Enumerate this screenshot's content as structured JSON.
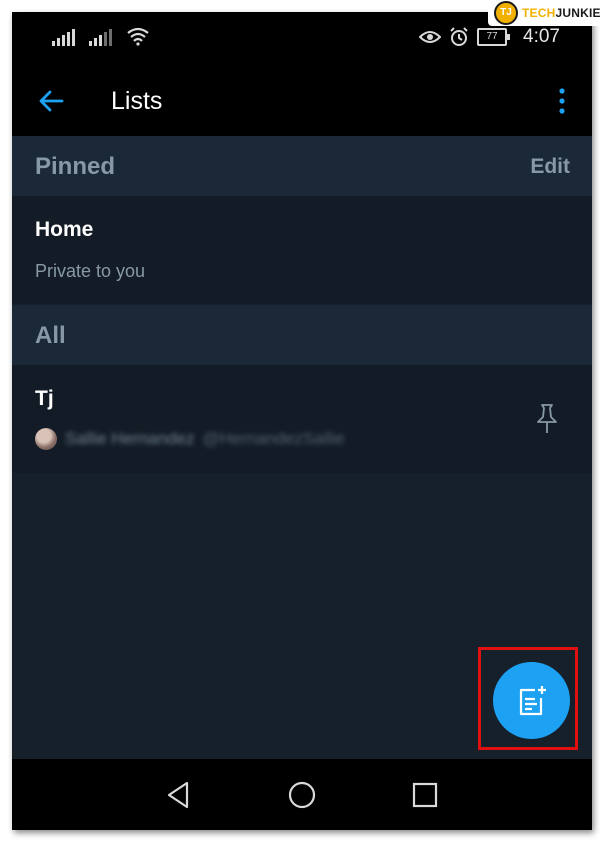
{
  "statusbar": {
    "battery": "77",
    "time": "4:07",
    "icons": [
      "signal-icon",
      "signal-icon",
      "wifi-icon",
      "eye-comfort-icon",
      "alarm-icon",
      "battery-icon"
    ]
  },
  "watermark": {
    "tech": "TECH",
    "junkie": "JUNKIE",
    "logo": "TJ"
  },
  "header": {
    "title": "Lists",
    "back_icon": "arrow-left-icon",
    "menu_icon": "more-vertical-icon"
  },
  "pinned": {
    "title": "Pinned",
    "edit_label": "Edit",
    "items": [
      {
        "name": "Home",
        "subtitle": "Private to you"
      }
    ]
  },
  "all": {
    "title": "All",
    "items": [
      {
        "name": "Tj",
        "owner_name": "Sallie Hernandez",
        "owner_handle": "@HernandezSallie",
        "pin_icon": "pin-icon"
      }
    ]
  },
  "fab": {
    "icon": "new-list-icon"
  },
  "navbar": {
    "icons": [
      "back-triangle-icon",
      "home-circle-icon",
      "recents-square-icon"
    ]
  },
  "colors": {
    "accent": "#1da1f2",
    "background": "#15202b",
    "section_header": "#1b2837",
    "muted_text": "#8899a6",
    "highlight": "#e01010"
  }
}
